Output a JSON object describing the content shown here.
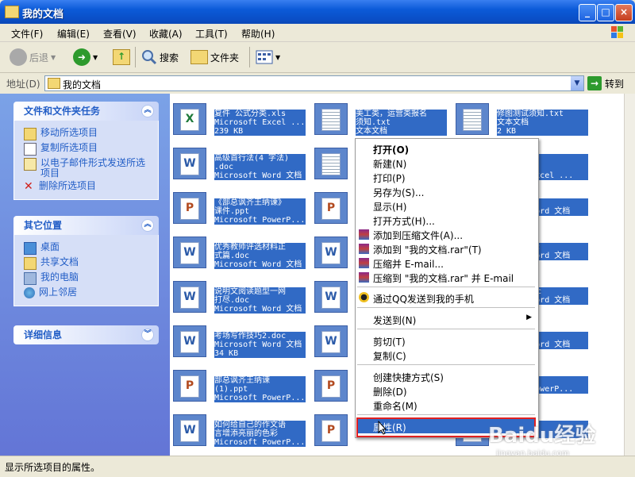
{
  "window": {
    "title": "我的文档",
    "buttons": {
      "minimize": "_",
      "maximize": "□",
      "close": "×"
    }
  },
  "menubar": {
    "items": [
      "文件(F)",
      "编辑(E)",
      "查看(V)",
      "收藏(A)",
      "工具(T)",
      "帮助(H)"
    ]
  },
  "toolbar": {
    "back": "后退",
    "search": "搜索",
    "folders": "文件夹"
  },
  "address": {
    "label": "地址(D)",
    "value": "我的文档",
    "go": "转到"
  },
  "left": {
    "tasks": {
      "title": "文件和文件夹任务",
      "items": [
        "移动所选项目",
        "复制所选项目",
        "以电子邮件形式发送所选项目",
        "删除所选项目"
      ]
    },
    "other": {
      "title": "其它位置",
      "items": [
        "桌面",
        "共享文档",
        "我的电脑",
        "网上邻居"
      ]
    },
    "details": {
      "title": "详细信息"
    }
  },
  "files": [
    {
      "type": "excel",
      "lines": "复件 公式分类.xls\nMicrosoft Excel ...\n239 KB"
    },
    {
      "type": "txt",
      "lines": "美工类，运营类报名\n须知.txt\n文本文档"
    },
    {
      "type": "txt",
      "lines": "修图测试须知.txt\n文本文档\n2 KB"
    },
    {
      "type": "word",
      "lines": "高级首行法(4 字法)\n.doc\nMicrosoft Word 文档"
    },
    {
      "type": "txt",
      "lines": ""
    },
    {
      "type": "excel",
      "lines": "rosoft\n作表.xls\nrosoft Excel ..."
    },
    {
      "type": "ppt",
      "lines": "《部总讽齐王纳谏》\n课件.ppt\nMicrosoft PowerP..."
    },
    {
      "type": "ppt",
      "lines": ""
    },
    {
      "type": "word",
      "lines": "doc\nrosoft Word 文档"
    },
    {
      "type": "word",
      "lines": "优秀教师评选材料正\n式篇.doc\nMicrosoft Word 文档"
    },
    {
      "type": "word",
      "lines": ""
    },
    {
      "type": "word",
      "lines": "二十招.doc\nrosoft Word 文档"
    },
    {
      "type": "word",
      "lines": "说明文阅读题型一网\n打尽.doc\nMicrosoft Word 文档"
    },
    {
      "type": "word",
      "lines": ""
    },
    {
      "type": "word",
      "lines": "技巧10.doc\nrosoft Word 文档"
    },
    {
      "type": "word",
      "lines": "考场写作技巧2.doc\nMicrosoft Word 文档\n34 KB"
    },
    {
      "type": "word",
      "lines": ""
    },
    {
      "type": "word",
      "lines": "合同.doc\nrosoft Word 文档"
    },
    {
      "type": "ppt",
      "lines": "部总讽齐王纳谏\n(1).ppt\nMicrosoft PowerP..."
    },
    {
      "type": "ppt",
      "lines": ""
    },
    {
      "type": "ppt",
      "lines": "ppt\nrosoft PowerP..."
    },
    {
      "type": "word",
      "lines": "如何给自己的作文语\n言增添亮丽的色彩\nMicrosoft PowerP..."
    },
    {
      "type": "ppt",
      "lines": "Microsoft PowerP..."
    },
    {
      "type": "ppt",
      "lines": "曲》《孙\n.doc"
    }
  ],
  "context_menu": {
    "open": "打开(O)",
    "new": "新建(N)",
    "print": "打印(P)",
    "save_as": "另存为(S)...",
    "show": "显示(H)",
    "open_with": "打开方式(H)...",
    "add_archive": "添加到压缩文件(A)...",
    "add_rar": "添加到 \"我的文档.rar\"(T)",
    "compress_email": "压缩并 E-mail...",
    "compress_rar_email": "压缩到 \"我的文档.rar\" 并 E-mail",
    "qq_send": "通过QQ发送到我的手机",
    "send_to": "发送到(N)",
    "cut": "剪切(T)",
    "copy": "复制(C)",
    "shortcut": "创建快捷方式(S)",
    "delete": "删除(D)",
    "rename": "重命名(M)",
    "properties": "属性(R)"
  },
  "status": {
    "text": "显示所选项目的属性。"
  },
  "watermark": {
    "brand": "Baidu经验",
    "url": "jingyan.baidu.com"
  }
}
